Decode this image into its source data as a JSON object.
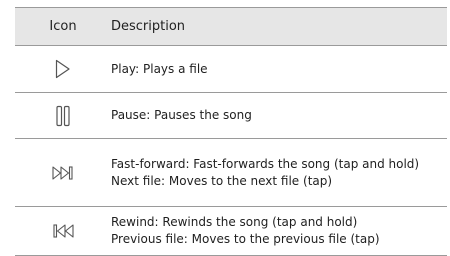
{
  "table": {
    "headers": {
      "icon": "Icon",
      "description": "Description"
    },
    "rows": [
      {
        "icon": "play-icon",
        "lines": [
          "Play: Plays a file"
        ]
      },
      {
        "icon": "pause-icon",
        "lines": [
          "Pause: Pauses the song"
        ]
      },
      {
        "icon": "fast-forward-next-icon",
        "lines": [
          "Fast-forward: Fast-forwards the song (tap and hold)",
          "Next file: Moves to the next file (tap)"
        ]
      },
      {
        "icon": "rewind-previous-icon",
        "lines": [
          "Rewind: Rewinds the song (tap and hold)",
          "Previous file: Moves to the previous file (tap)"
        ]
      }
    ]
  }
}
